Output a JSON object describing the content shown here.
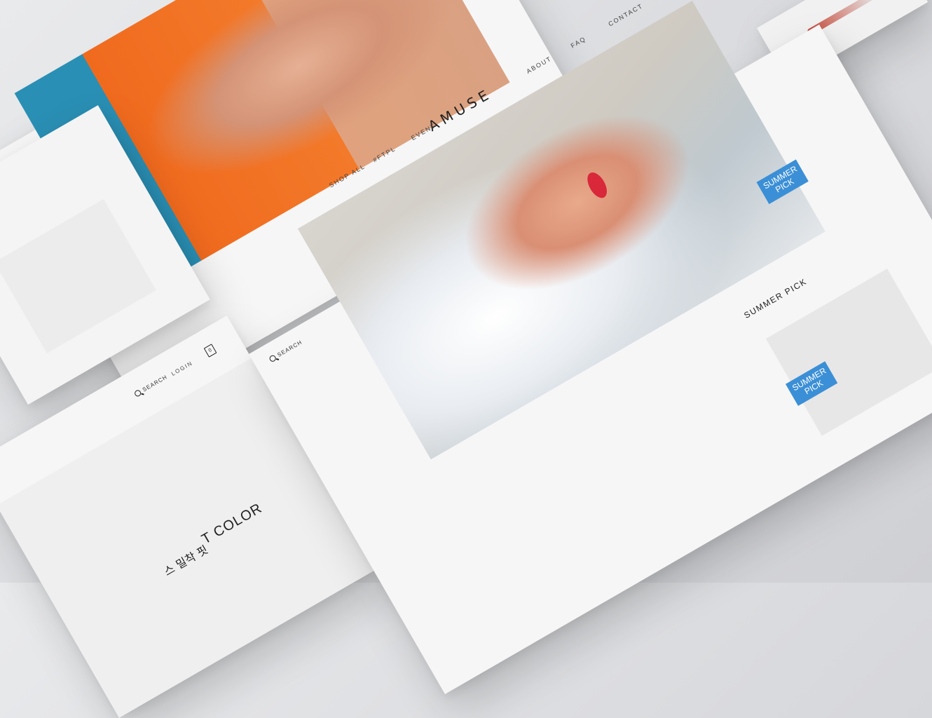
{
  "main": {
    "logo": "AMUSE",
    "nav": [
      "SHOP ALL",
      "#FTPL",
      "EVENT",
      "ABOUT",
      "FAQ",
      "CONTACT"
    ],
    "search": "SEARCH",
    "section_title": "SUMMER PICK",
    "badge_line1": "SUMMER",
    "badge_line2": "PICK"
  },
  "left": {
    "search": "SEARCH",
    "login": "LOGIN",
    "cart_count": "0",
    "korean_text": "스 밀착 핏",
    "headline": "T COLOR"
  },
  "colors": {
    "accent_blue": "#3b8fd6",
    "lip_red": "#d8283a",
    "orange": "#f06a1e"
  }
}
